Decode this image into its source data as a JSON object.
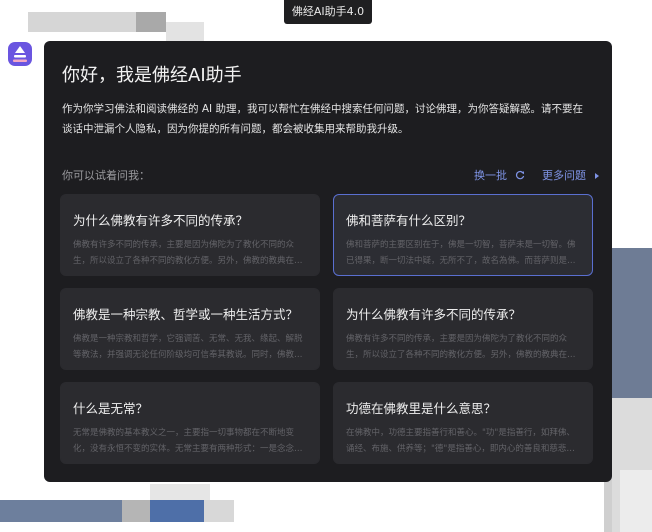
{
  "window": {
    "title": "佛经AI助手4.0"
  },
  "logo": {
    "icon": "assistant-logo-icon",
    "color": "#6a55e0"
  },
  "chat": {
    "heading": "你好，我是佛经AI助手",
    "intro": "作为你学习佛法和阅读佛经的 AI 助理，我可以帮忙在佛经中搜索任何问题，讨论佛理，为你答疑解惑。请不要在谈话中泄漏个人隐私，因为你提的所有问题，都会被收集用来帮助我升级。",
    "suggest_hint": "你可以试着问我：",
    "refresh_label": "换一批",
    "more_label": "更多问题",
    "cards": [
      {
        "question": "为什么佛教有许多不同的传承？",
        "answer": "佛教有许多不同的传承，主要是因为佛陀为了教化不同的众生，所以设立了各种不同的教化方便。另外，佛教的教典在…"
      },
      {
        "question": "佛和菩萨有什么区别？",
        "answer": "佛和菩萨的主要区别在于，佛是一切智，菩萨未是一切智。佛已得果，断一切法中疑，无所不了，故名為佛。而菩萨则是…"
      },
      {
        "question": "佛教是一种宗教、哲学或一种生活方式？",
        "answer": "佛教是一种宗教和哲学，它强调苦、无常、无我、缘起、解脱等教法，并强调无论任何阶级均可信奉其教说。同时，佛教…"
      },
      {
        "question": "为什么佛教有许多不同的传承？",
        "answer": "佛教有许多不同的传承，主要是因为佛陀为了教化不同的众生，所以设立了各种不同的教化方便。另外，佛教的教典在…"
      },
      {
        "question": "什么是无常？",
        "answer": "无常是佛教的基本教义之一，主要指一切事物都在不断地变化，没有永恒不变的实体。无常主要有两种形式：一是念念…"
      },
      {
        "question": "功德在佛教里是什么意思？",
        "answer": "在佛教中，功德主要指善行和善心。\"功\"是指善行，如拜佛、诵经、布施、供养等；\"德\"是指善心，即内心的善良和慈悲…"
      }
    ]
  }
}
